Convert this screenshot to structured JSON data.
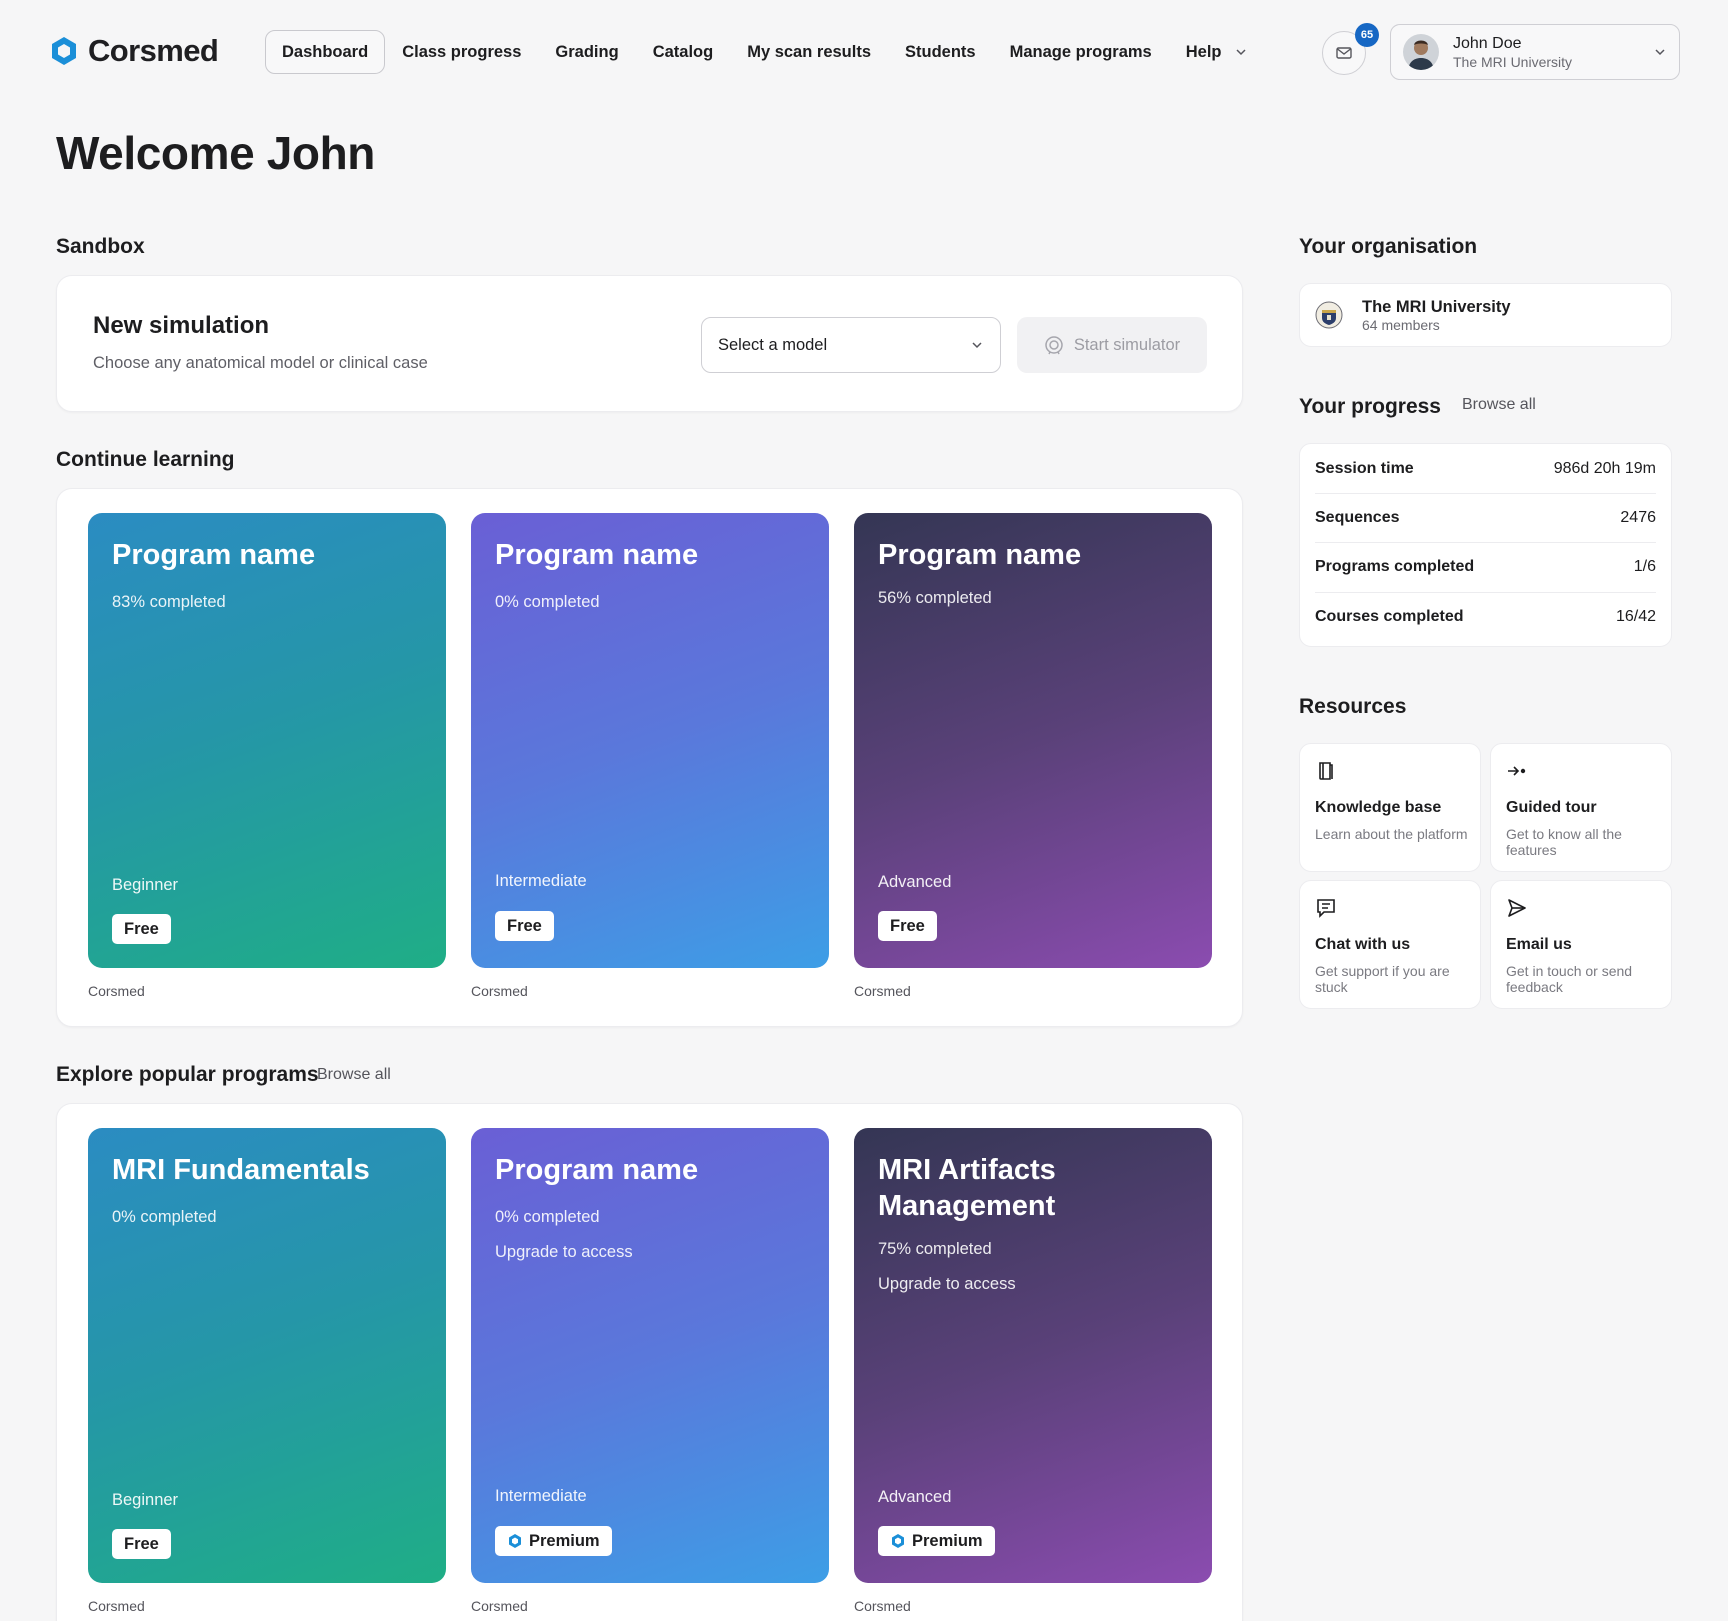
{
  "brand": {
    "name": "Corsmed",
    "accent": "#1b8fd8"
  },
  "nav": {
    "items": [
      "Dashboard",
      "Class progress",
      "Grading",
      "Catalog",
      "My scan results",
      "Students",
      "Manage programs"
    ],
    "help_label": "Help",
    "active": "Dashboard"
  },
  "notifications": {
    "count": "65",
    "icon": "mail-icon"
  },
  "user": {
    "name": "John Doe",
    "organisation": "The MRI University"
  },
  "welcome": "Welcome John",
  "sandbox": {
    "heading": "Sandbox",
    "title": "New simulation",
    "subtitle": "Choose any anatomical model or clinical case",
    "select_placeholder": "Select a model",
    "start_label": "Start simulator"
  },
  "continue_learning": {
    "heading": "Continue learning",
    "cards": [
      {
        "title": "Program name",
        "progress": "83% completed",
        "level": "Beginner",
        "tag": "Free",
        "source": "Corsmed",
        "theme": "teal"
      },
      {
        "title": "Program name",
        "progress": "0% completed",
        "level": "Intermediate",
        "tag": "Free",
        "source": "Corsmed",
        "theme": "blue"
      },
      {
        "title": "Program name",
        "progress": "56% completed",
        "level": "Advanced",
        "tag": "Free",
        "source": "Corsmed",
        "theme": "purple"
      }
    ]
  },
  "explore": {
    "heading": "Explore popular programs",
    "browse_label": "Browse all",
    "cards": [
      {
        "title": "MRI Fundamentals",
        "progress": "0% completed",
        "level": "Beginner",
        "tag": "Free",
        "source": "Corsmed",
        "theme": "teal"
      },
      {
        "title": "Program name",
        "progress": "0% completed",
        "access": "Upgrade to access",
        "level": "Intermediate",
        "tag": "Premium",
        "source": "Corsmed",
        "theme": "blue"
      },
      {
        "title": "MRI Artifacts Management",
        "progress": "75% completed",
        "access": "Upgrade to access",
        "level": "Advanced",
        "tag": "Premium",
        "source": "Corsmed",
        "theme": "purple"
      }
    ]
  },
  "organisation": {
    "heading": "Your organisation",
    "name": "The MRI University",
    "members": "64 members"
  },
  "progress": {
    "heading": "Your progress",
    "browse_label": "Browse all",
    "rows": [
      {
        "label": "Session time",
        "value": "986d 20h 19m"
      },
      {
        "label": "Sequences",
        "value": "2476"
      },
      {
        "label": "Programs completed",
        "value": "1/6"
      },
      {
        "label": "Courses completed",
        "value": "16/42"
      }
    ]
  },
  "resources": {
    "heading": "Resources",
    "items": [
      {
        "title": "Knowledge base",
        "desc": "Learn about the platform",
        "icon": "book-icon"
      },
      {
        "title": "Guided tour",
        "desc": "Get to know all the features",
        "icon": "tour-arrow-icon"
      },
      {
        "title": "Chat with us",
        "desc": "Get support if you are stuck",
        "icon": "chat-icon"
      },
      {
        "title": "Email us",
        "desc": "Get in touch or send feedback",
        "icon": "send-icon"
      }
    ]
  }
}
